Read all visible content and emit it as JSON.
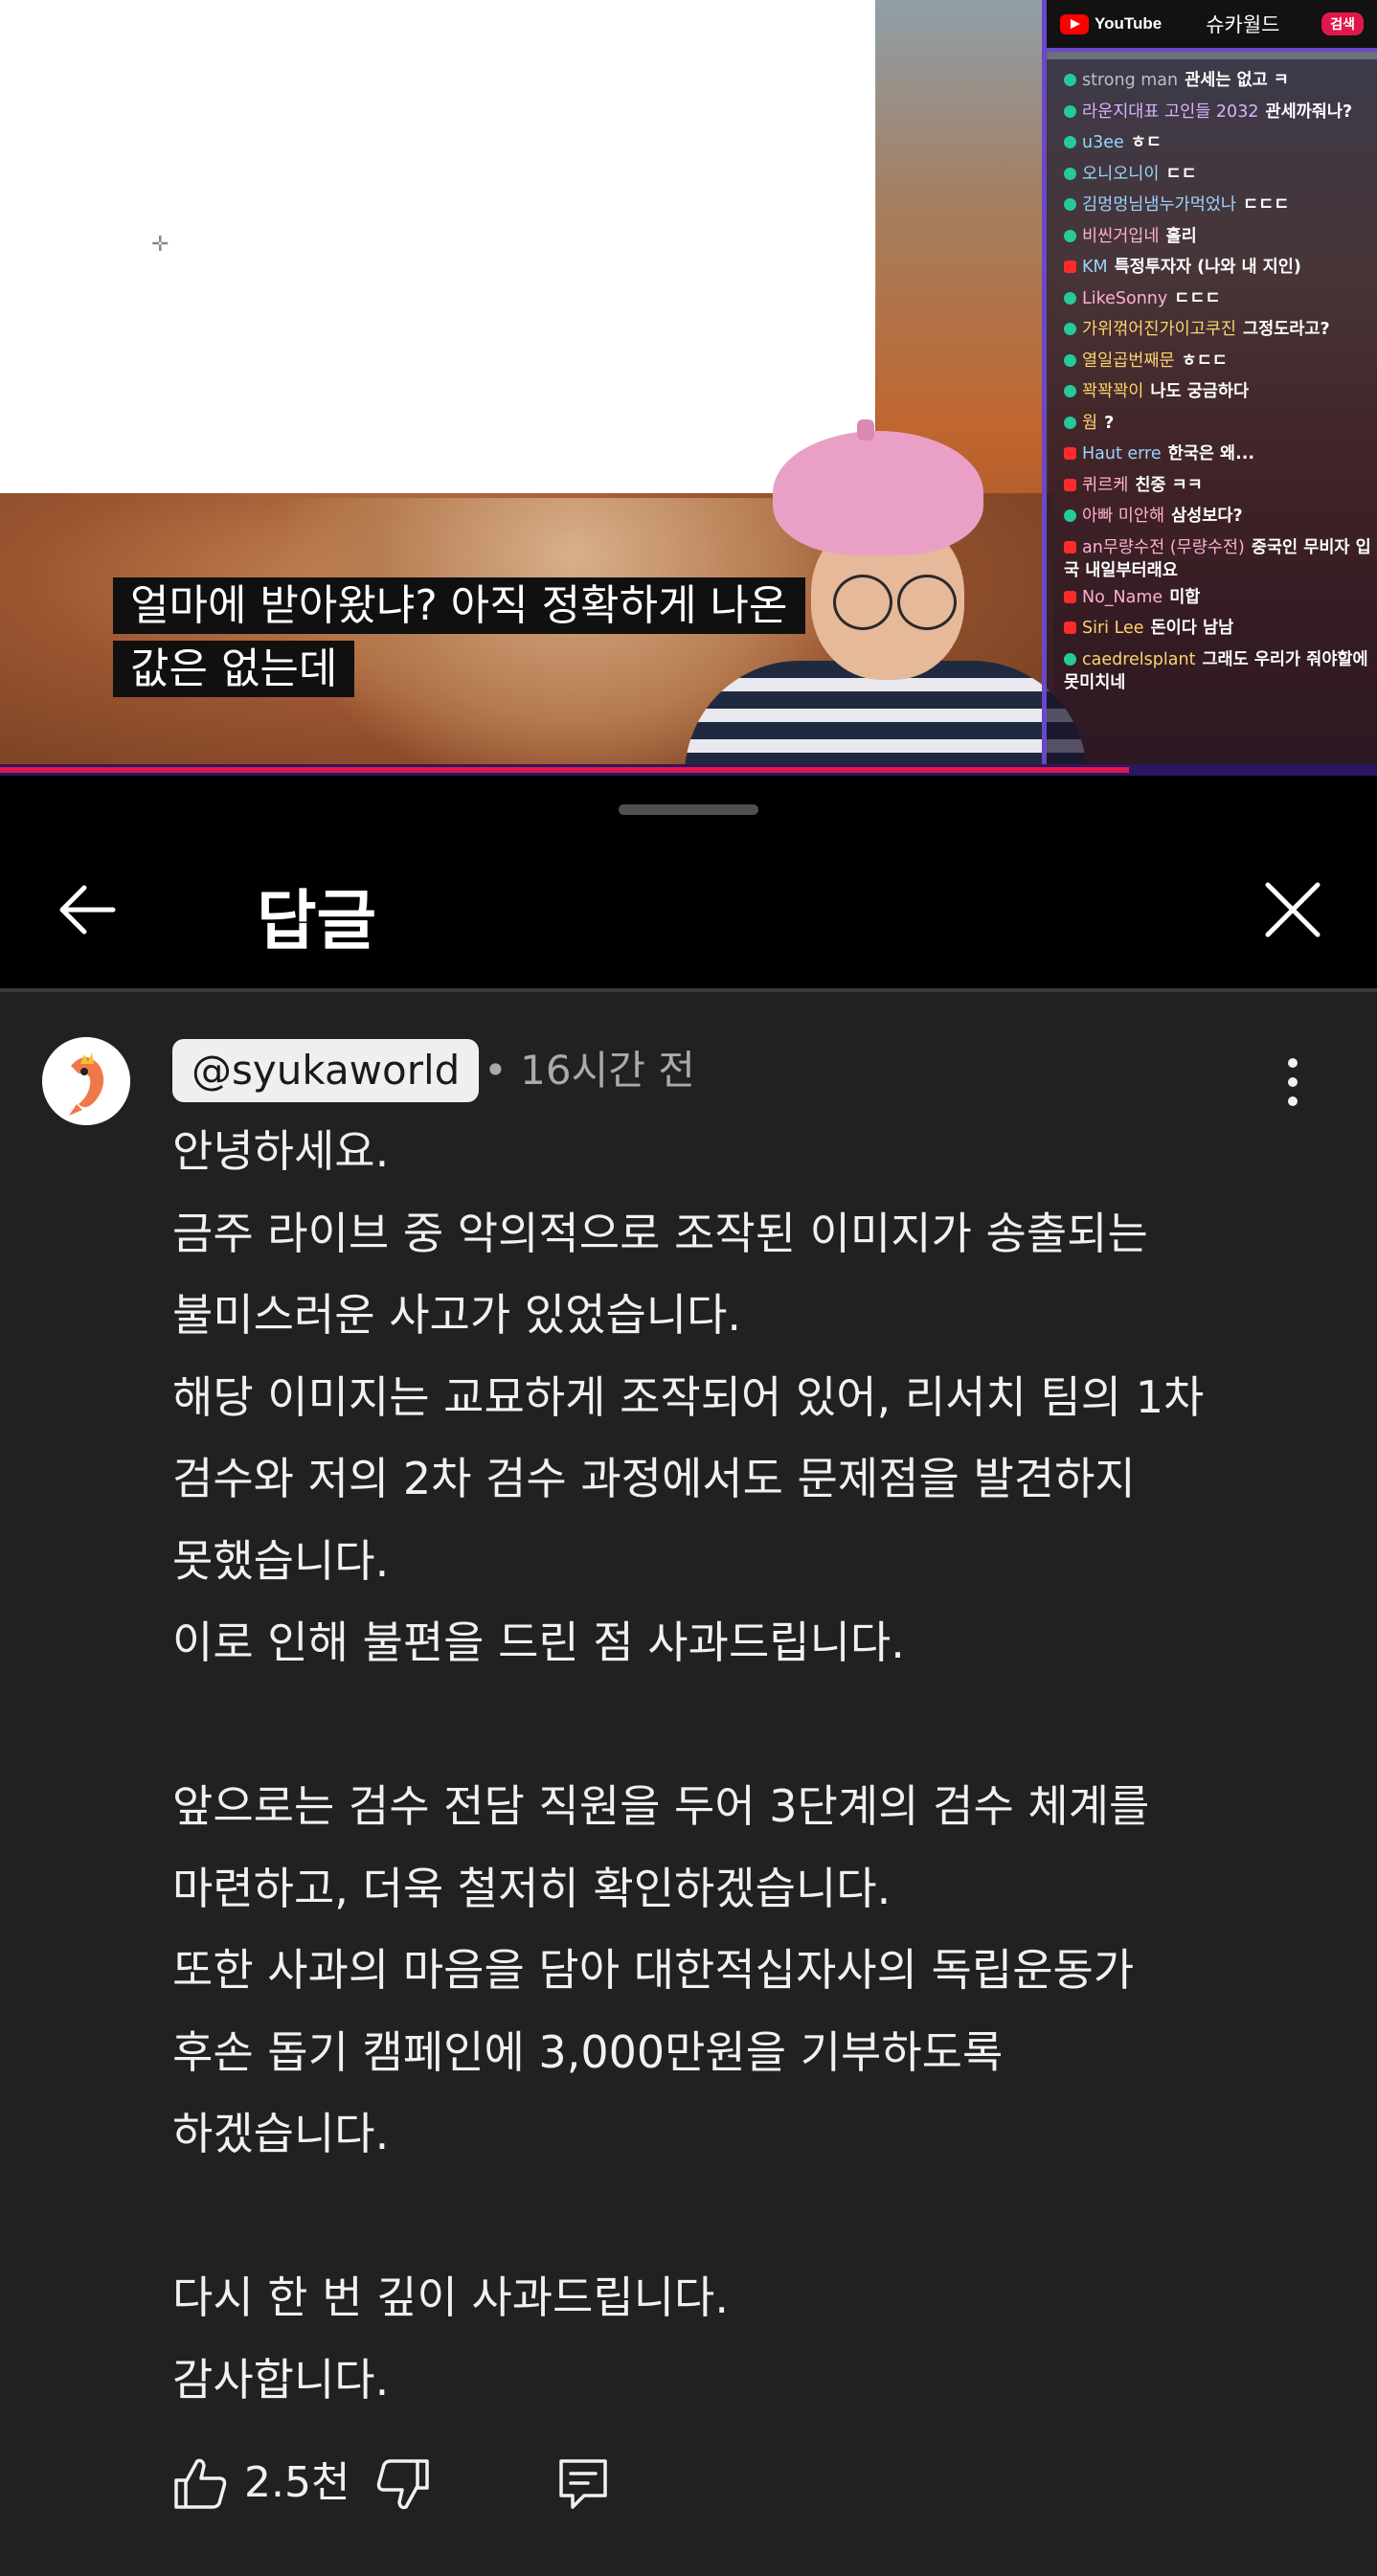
{
  "video": {
    "caption_lines": [
      "얼마에 받아왔냐? 아직 정확하게 나온",
      "값은 없는데"
    ],
    "progress_fraction": 0.82
  },
  "chat": {
    "brand": "YouTube",
    "title": "슈카월드",
    "search_label": "검색",
    "messages": [
      {
        "icon": "chzzk-icon",
        "name": "strong man",
        "msg": "관세는 없고 ㅋ",
        "name_color": "#bfbfbf"
      },
      {
        "icon": "chzzk-icon",
        "name": "라운지대표 고인들 2032",
        "msg": "관세까줘나?",
        "name_color": "#d9b3ff"
      },
      {
        "icon": "chzzk-icon",
        "name": "u3ee",
        "msg": "ㅎㄷ",
        "name_color": "#9ad6ff"
      },
      {
        "icon": "chzzk-icon",
        "name": "오니오니이",
        "msg": "ㄷㄷ",
        "name_color": "#9ad6ff"
      },
      {
        "icon": "chzzk-icon",
        "name": "김멍멍님냄누가먹었나",
        "msg": "ㄷㄷㄷ",
        "name_color": "#9ad6ff"
      },
      {
        "icon": "chzzk-icon",
        "name": "비씬거입네",
        "msg": "홀리",
        "name_color": "#ffb0d0"
      },
      {
        "icon": "youtube-icon",
        "name": "KM",
        "msg": "특정투자자 (나와 내 지인)",
        "name_color": "#9ad6ff"
      },
      {
        "icon": "chzzk-icon",
        "name": "LikeSonny",
        "msg": "ㄷㄷㄷ",
        "name_color": "#ffb0d0"
      },
      {
        "icon": "chzzk-icon",
        "name": "가위꺾어진가이고쿠진",
        "msg": "그정도라고?",
        "name_color": "#ffd36b"
      },
      {
        "icon": "chzzk-icon",
        "name": "열일곱번째문",
        "msg": "ㅎㄷㄷ",
        "name_color": "#ffd36b"
      },
      {
        "icon": "chzzk-icon",
        "name": "꽉꽉꽉이",
        "msg": "나도 궁금하다",
        "name_color": "#ffd36b"
      },
      {
        "icon": "chzzk-icon",
        "name": "웜",
        "msg": "?",
        "name_color": "#ffd36b"
      },
      {
        "icon": "youtube-icon",
        "name": "Haut erre",
        "msg": "한국은 왜...",
        "name_color": "#9ad6ff"
      },
      {
        "icon": "youtube-icon",
        "name": "퀴르케",
        "msg": "친중 ㅋㅋ",
        "name_color": "#ffb0d0"
      },
      {
        "icon": "chzzk-icon",
        "name": "아빠 미안해",
        "msg": "삼성보다?",
        "name_color": "#ffb0d0"
      },
      {
        "icon": "youtube-icon",
        "name": "an무량수전 (무량수전)",
        "msg": "중국인 무비자 입국 내일부터래요",
        "name_color": "#ffb0d0",
        "wrap": true
      },
      {
        "icon": "youtube-icon",
        "name": "No_Name",
        "msg": "미합",
        "name_color": "#ffb0d0"
      },
      {
        "icon": "youtube-icon",
        "name": "Siri Lee",
        "msg": "돈이다 남남",
        "name_color": "#ffd36b"
      },
      {
        "icon": "chzzk-icon",
        "name": "caedrelsplant",
        "msg": "그래도 우리가 줘야할에 못미치네",
        "name_color": "#ffd36b",
        "wrap": true
      }
    ]
  },
  "sheet": {
    "title": "답글"
  },
  "comment": {
    "author": "@syukaworld",
    "timestamp": "• 16시간 전",
    "lines": [
      "안녕하세요.",
      "금주 라이브 중 악의적으로 조작된 이미지가 송출되는",
      "불미스러운 사고가 있었습니다.",
      "해당 이미지는 교묘하게 조작되어 있어, 리서치 팀의 1차",
      "검수와 저의 2차 검수 과정에서도 문제점을 발견하지",
      "못했습니다.",
      "이로 인해 불편을 드린 점 사과드립니다.",
      "",
      "앞으로는 검수 전담 직원을 두어 3단계의 검수 체계를",
      "마련하고, 더욱 철저히 확인하겠습니다.",
      "또한 사과의 마음을 담아 대한적십자사의 독립운동가",
      "후손 돕기 캠페인에 3,000만원을 기부하도록",
      "하겠습니다.",
      "",
      "다시 한 번 깊이 사과드립니다.",
      "감사합니다."
    ],
    "like_count": "2.5천"
  },
  "colors": {
    "background": "#212121",
    "header_background": "#000000",
    "progress": "#e0174b",
    "chat_border": "#6b48c9"
  }
}
